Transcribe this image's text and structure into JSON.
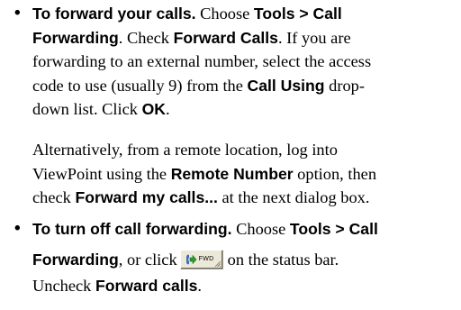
{
  "item1": {
    "bullet": "•",
    "line1": {
      "b1": "To forward your calls.",
      "t1": " Choose ",
      "b2": "Tools > Call"
    },
    "line2": {
      "b1": "Forwarding",
      "t1": ". Check ",
      "b2": "Forward Calls",
      "t2": ". If you are"
    },
    "line3": {
      "t1": "forwarding to an external number, select the access"
    },
    "line4": {
      "t1": "code to use (usually 9) from the ",
      "b1": "Call Using",
      "t2": " drop-"
    },
    "line5": {
      "t1": "down list. Click ",
      "b1": "OK",
      "t2": "."
    }
  },
  "item1_alt": {
    "line1": {
      "t1": "Alternatively, from a remote location, log into"
    },
    "line2": {
      "t1": "ViewPoint using the ",
      "b1": "Remote Number",
      "t2": " option, then"
    },
    "line3": {
      "t1": "check ",
      "b1": "Forward my calls...",
      "t2": " at the next dialog box."
    }
  },
  "item2": {
    "bullet": "•",
    "line1": {
      "b1": "To turn off call forwarding.",
      "t1": " Choose ",
      "b2": "Tools > Call"
    },
    "line2": {
      "b1": "Forwarding",
      "t1": ", or click",
      "t2": "on the status bar."
    },
    "line3": {
      "t1": "Uncheck ",
      "b1": "Forward calls",
      "t2": "."
    }
  },
  "fwd_button": {
    "label": "FWD",
    "icon": "call-forward-arrow-icon",
    "grip_icon": "resize-grip-icon",
    "colors": {
      "face": "#ece9d8",
      "arrow": "#2e9a2e",
      "handset": "#3a6fc4"
    }
  }
}
